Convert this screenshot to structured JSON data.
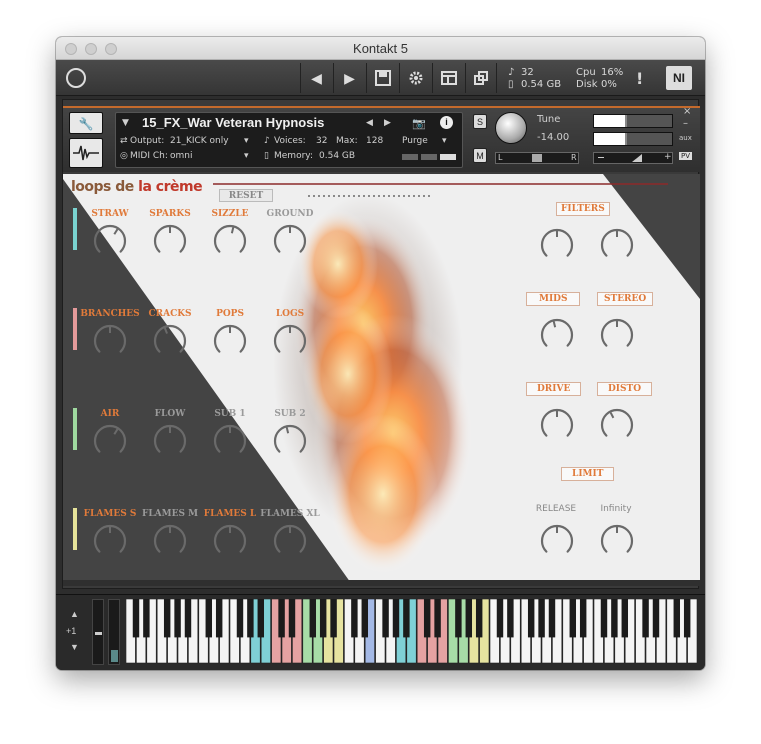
{
  "window": {
    "title": "Kontakt 5"
  },
  "toolbar": {
    "prev_label": "◀",
    "next_label": "▶",
    "voices_value": "32",
    "memory_value": "0.54 GB",
    "cpu_label": "Cpu",
    "cpu_value": "16%",
    "disk_label": "Disk",
    "disk_value": "0%",
    "warning_label": "!",
    "ni_label": "NI"
  },
  "instrument": {
    "name": "15_FX_War Veteran Hypnosis",
    "output_label": "Output:",
    "output_value": "21_KICK only",
    "voices_label": "Voices:",
    "voices_value": "32",
    "max_label": "Max:",
    "max_value": "128",
    "purge_label": "Purge",
    "midi_label": "MIDI Ch:",
    "midi_value": "omni",
    "memory_label": "Memory:",
    "memory_value": "0.54 GB",
    "solo_label": "S",
    "mute_label": "M",
    "tune_label": "Tune",
    "tune_value": "-14.00",
    "pan_left": "L",
    "pan_right": "R",
    "aux_label": "aux",
    "pv_label": "PV"
  },
  "panel": {
    "logo_part1": "loops de ",
    "logo_part2": "la crème",
    "reset_label": "RESET",
    "rows": [
      {
        "color": "#7ad3d0",
        "knobs": [
          {
            "label": "STRAW",
            "style": "orange",
            "value": 0.62
          },
          {
            "label": "SPARKS",
            "style": "orange",
            "value": 0.5
          },
          {
            "label": "SIZZLE",
            "style": "orange",
            "value": 0.55
          },
          {
            "label": "GROUND",
            "style": "gray",
            "value": 0.5
          }
        ]
      },
      {
        "color": "#e49a9a",
        "knobs": [
          {
            "label": "BRANCHES",
            "style": "orange",
            "value": 0.5
          },
          {
            "label": "CRACKS",
            "style": "orange",
            "value": 0.42
          },
          {
            "label": "POPS",
            "style": "orange",
            "value": 0.5
          },
          {
            "label": "LOGS",
            "style": "orange",
            "value": 0.5
          }
        ]
      },
      {
        "color": "#9fd99f",
        "knobs": [
          {
            "label": "AIR",
            "style": "orange",
            "value": 0.62
          },
          {
            "label": "FLOW",
            "style": "gray",
            "value": 0.5
          },
          {
            "label": "SUB 1",
            "style": "gray",
            "value": 0.5
          },
          {
            "label": "SUB 2",
            "style": "gray",
            "value": 0.45
          }
        ]
      },
      {
        "color": "#e6e39a",
        "knobs": [
          {
            "label": "FLAMES S",
            "style": "orange",
            "value": 0.5
          },
          {
            "label": "FLAMES M",
            "style": "gray",
            "value": 0.5
          },
          {
            "label": "FLAMES L",
            "style": "orange",
            "value": 0.5
          },
          {
            "label": "FLAMES XL",
            "style": "gray",
            "value": 0.5
          }
        ]
      }
    ],
    "fx": {
      "filters_label": "FILTERS",
      "mids_label": "MIDS",
      "stereo_label": "STEREO",
      "drive_label": "DRIVE",
      "disto_label": "DISTO",
      "limit_label": "LIMIT",
      "release_label": "RELEASE",
      "infinity_label": "Infinity",
      "filter_a": 0.5,
      "filter_b": 0.5,
      "mids_value": 0.45,
      "stereo_value": 0.5,
      "drive_value": 0.5,
      "disto_value": 0.4,
      "release_value": 0.5,
      "infinity_value": 0.5
    }
  },
  "keyboard": {
    "octave_label": "+1",
    "colors": {
      "cyan": "#7fd0d6",
      "pink": "#e5a2a2",
      "green": "#a7dca7",
      "yellow": "#e6e3a0",
      "blue": "#a4b9e6"
    }
  }
}
